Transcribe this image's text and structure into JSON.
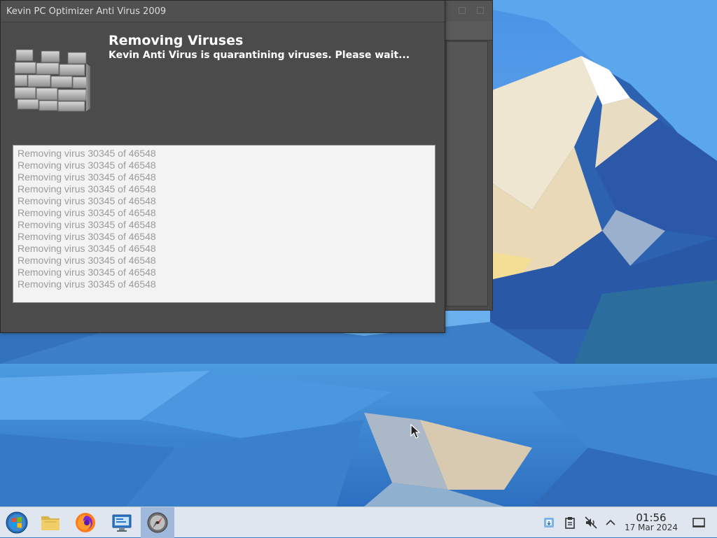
{
  "dialog": {
    "title": "Kevin PC Optimizer Anti Virus 2009",
    "heading": "Removing Viruses",
    "subheading": "Kevin Anti Virus is quarantining viruses. Please wait...",
    "log_lines": [
      "Removing virus 30345 of 46548",
      "Removing virus 30345 of 46548",
      "Removing virus 30345 of 46548",
      "Removing virus 30345 of 46548",
      "Removing virus 30345 of 46548",
      "Removing virus 30345 of 46548",
      "Removing virus 30345 of 46548",
      "Removing virus 30345 of 46548",
      "Removing virus 30345 of 46548",
      "Removing virus 30345 of 46548",
      "Removing virus 30345 of 46548",
      "Removing virus 30345 of 46548"
    ],
    "icon": "brick-wall-firewall-icon"
  },
  "taskbar": {
    "items": [
      {
        "name": "start-menu-button",
        "icon": "windows-orb-icon"
      },
      {
        "name": "file-manager-button",
        "icon": "folder-icon"
      },
      {
        "name": "firefox-button",
        "icon": "firefox-icon"
      },
      {
        "name": "remote-desktop-button",
        "icon": "monitor-icon"
      },
      {
        "name": "antivirus-task-button",
        "icon": "compass-icon",
        "active": true
      }
    ],
    "tray": [
      "update-notifier-icon",
      "clipboard-icon",
      "volume-muted-icon",
      "chevron-up-icon"
    ],
    "clock": {
      "time": "01:56",
      "date": "17 Mar 2024"
    },
    "show_desktop_icon": "show-desktop-icon"
  },
  "colors": {
    "dialog_bg": "#4b4b4b",
    "log_bg": "#f3f3f3",
    "log_text": "#9b9b9b",
    "taskbar_bg": "#dfe6ef",
    "active_task": "#9fb9dc"
  }
}
